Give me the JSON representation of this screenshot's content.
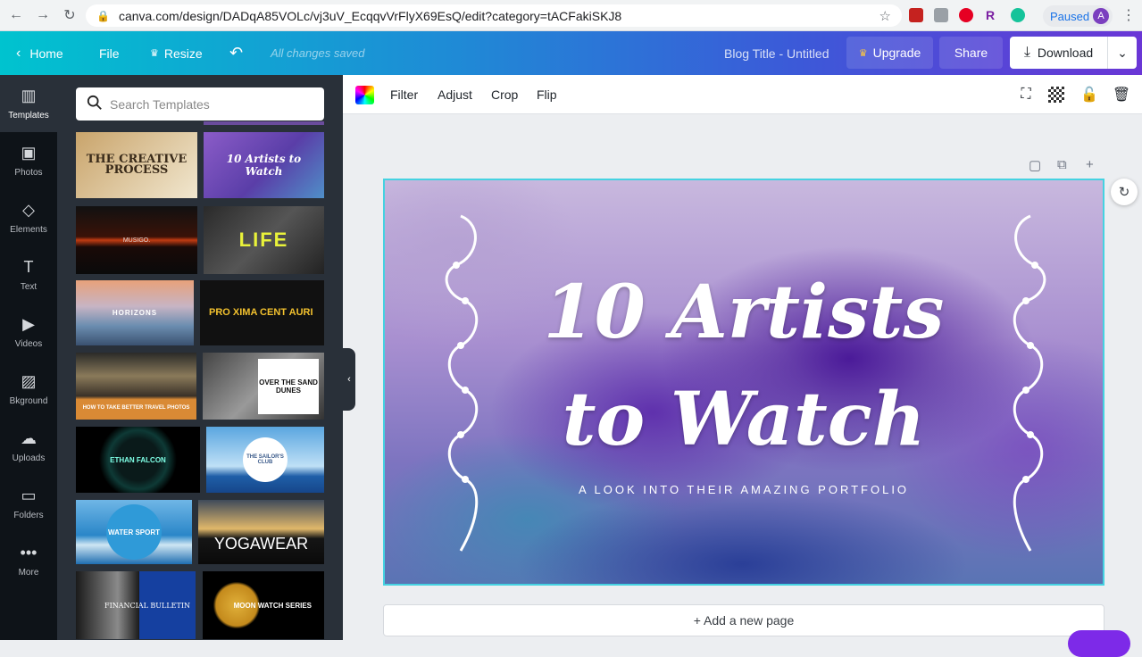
{
  "browser": {
    "url": "canva.com/design/DADqA85VOLc/vj3uV_EcqqvVrFlyX69EsQ/edit?category=tACFakiSKJ8",
    "profile_status": "Paused",
    "avatar_letter": "A"
  },
  "topbar": {
    "home": "Home",
    "file": "File",
    "resize": "Resize",
    "saved_status": "All changes saved",
    "design_title": "Blog Title - Untitled",
    "upgrade": "Upgrade",
    "share": "Share",
    "download": "Download"
  },
  "sidebar": {
    "items": [
      {
        "label": "Templates",
        "icon": "templates-icon"
      },
      {
        "label": "Photos",
        "icon": "photos-icon"
      },
      {
        "label": "Elements",
        "icon": "elements-icon"
      },
      {
        "label": "Text",
        "icon": "text-icon"
      },
      {
        "label": "Videos",
        "icon": "videos-icon"
      },
      {
        "label": "Bkground",
        "icon": "background-icon"
      },
      {
        "label": "Uploads",
        "icon": "uploads-icon"
      },
      {
        "label": "Folders",
        "icon": "folders-icon"
      },
      {
        "label": "More",
        "icon": "more-icon"
      }
    ]
  },
  "panel": {
    "search_placeholder": "Search Templates",
    "templates": [
      {
        "text": "THE CREATIVE PROCESS"
      },
      {
        "text": "10 Artists to Watch"
      },
      {
        "text": "MUSIGO."
      },
      {
        "text": "LIFE"
      },
      {
        "text": "HORIZONS"
      },
      {
        "text": "PRO XIMA CENT AURI"
      },
      {
        "text": "HOW TO TAKE BETTER TRAVEL PHOTOS"
      },
      {
        "text": "OVER THE SAND DUNES"
      },
      {
        "text": "ETHAN FALCON"
      },
      {
        "text": "THE SAILOR'S CLUB"
      },
      {
        "text": "WATER SPORT"
      },
      {
        "text": "YOGAWEAR"
      },
      {
        "text": "FINANCIAL BULLETIN"
      },
      {
        "text": "MOON WATCH SERIES"
      }
    ]
  },
  "toolbar": {
    "filter": "Filter",
    "adjust": "Adjust",
    "crop": "Crop",
    "flip": "Flip"
  },
  "canvas": {
    "title_line1": "10 Artists",
    "title_line2": "to Watch",
    "subtitle": "A LOOK INTO THEIR AMAZING PORTFOLIO"
  },
  "add_page": "+ Add a new page"
}
